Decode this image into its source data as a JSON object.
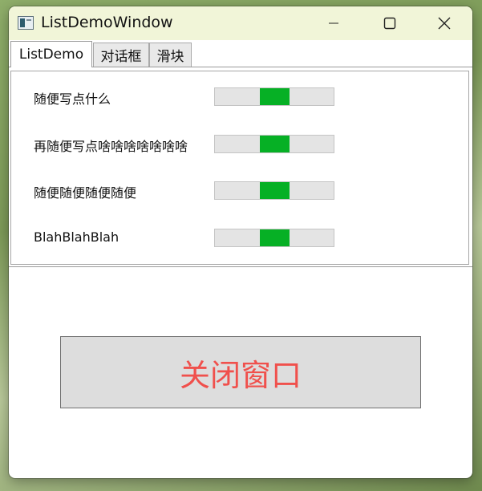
{
  "window": {
    "title": "ListDemoWindow",
    "icon": "app-window-icon",
    "controls": {
      "minimize_icon": "minimize-icon",
      "maximize_icon": "maximize-icon",
      "close_icon": "close-icon"
    }
  },
  "tabs": [
    {
      "label": "ListDemo",
      "active": true
    },
    {
      "label": "对话框",
      "active": false
    },
    {
      "label": "滑块",
      "active": false
    }
  ],
  "list": {
    "items": [
      {
        "label": "随便写点什么",
        "slider_value": 0.5
      },
      {
        "label": "再随便写点啥啥啥啥啥啥啥",
        "slider_value": 0.5
      },
      {
        "label": "随便随便随便随便",
        "slider_value": 0.5
      },
      {
        "label": "BlahBlahBlah",
        "slider_value": 0.5
      }
    ]
  },
  "close_button": {
    "label": "关闭窗口"
  },
  "colors": {
    "titlebar": "#f1f5d8",
    "slider_thumb": "#06b025",
    "slider_track": "#e4e4e4",
    "close_label": "#f0504c"
  }
}
